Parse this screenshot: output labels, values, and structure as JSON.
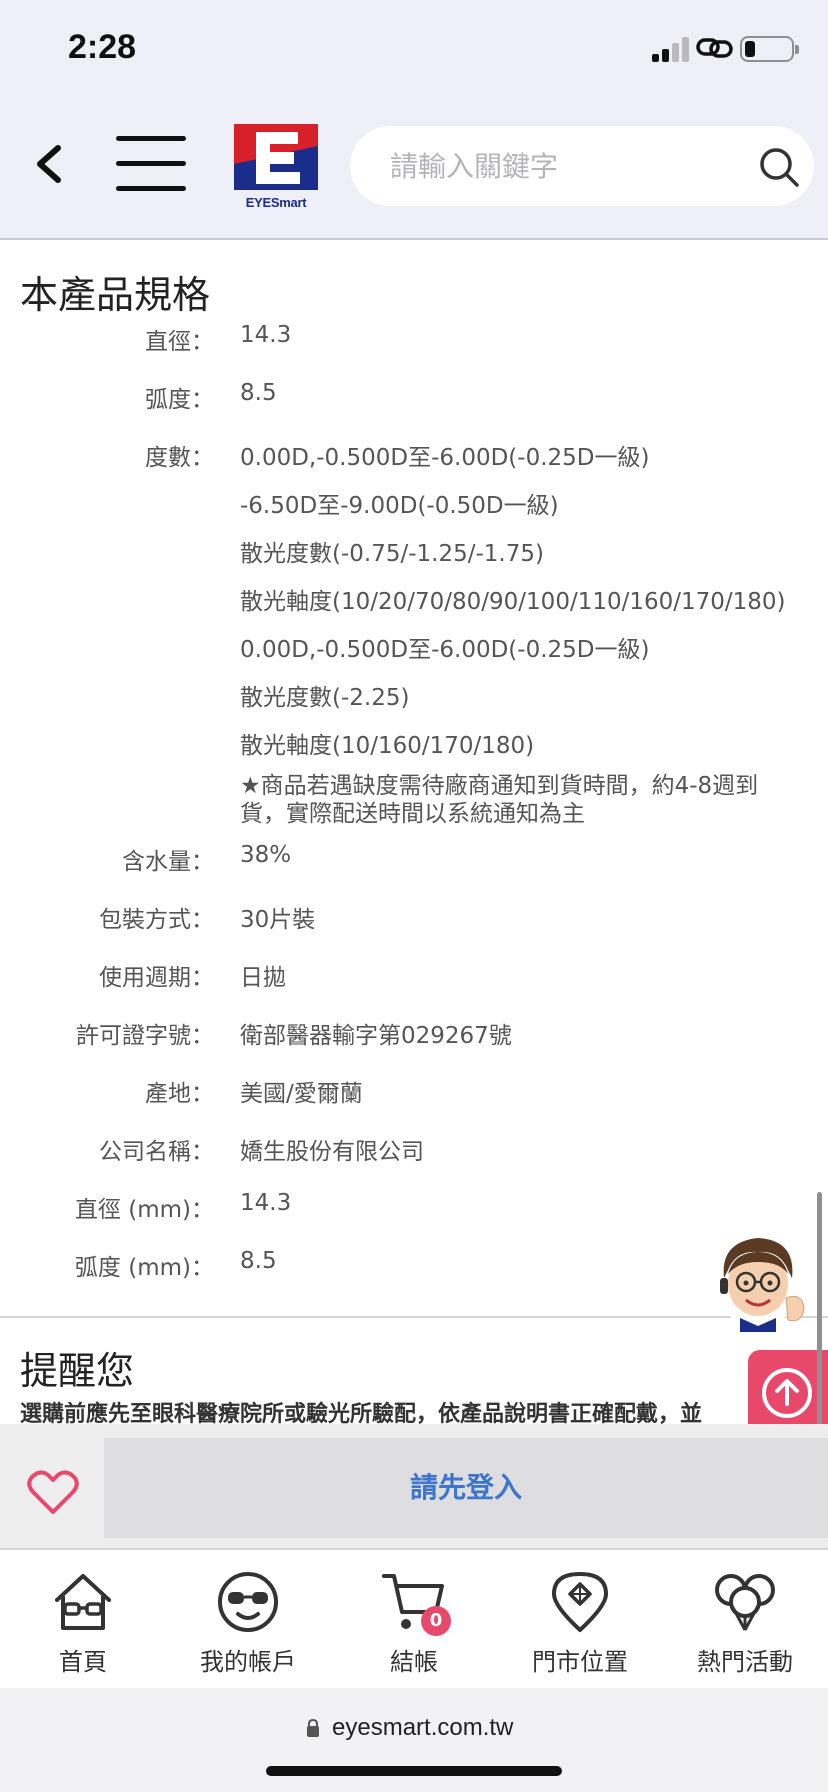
{
  "status_bar": {
    "time": "2:28"
  },
  "header": {
    "logo_text": "EYESmart",
    "search_placeholder": "請輸入關鍵字"
  },
  "specs": {
    "title": "本產品規格",
    "rows": [
      {
        "label": "直徑：",
        "value": "14.3"
      },
      {
        "label": "弧度：",
        "value": "8.5"
      },
      {
        "label": "度數：",
        "lines": [
          "0.00D,-0.500D至-6.00D(-0.25D一級)",
          "-6.50D至-9.00D(-0.50D一級)",
          "散光度數(-0.75/-1.25/-1.75)",
          "散光軸度(10/20/70/80/90/100/110/160/170/180)",
          "0.00D,-0.500D至-6.00D(-0.25D一級)",
          "散光度數(-2.25)",
          "散光軸度(10/160/170/180)"
        ],
        "note": "★商品若遇缺度需待廠商通知到貨時間，約4-8週到貨，實際配送時間以系統通知為主"
      },
      {
        "label": "含水量：",
        "value": "38%"
      },
      {
        "label": "包裝方式：",
        "value": "30片裝"
      },
      {
        "label": "使用週期：",
        "value": "日拋"
      },
      {
        "label": "許可證字號：",
        "value": "衛部醫器輸字第029267號"
      },
      {
        "label": "產地：",
        "value": "美國/愛爾蘭"
      },
      {
        "label": "公司名稱：",
        "value": "嬌生股份有限公司"
      },
      {
        "label": "直徑 (mm)：",
        "value": "14.3"
      },
      {
        "label": "弧度 (mm)：",
        "value": "8.5"
      }
    ]
  },
  "reminder": {
    "title": "提醒您",
    "text": "選購前應先至眼科醫療院所或驗光所驗配，依產品說明書正確配戴，並"
  },
  "action_bar": {
    "login_label": "請先登入"
  },
  "tab_bar": {
    "items": [
      {
        "label": "首頁",
        "icon": "home-icon"
      },
      {
        "label": "我的帳戶",
        "icon": "account-icon"
      },
      {
        "label": "結帳",
        "icon": "cart-icon",
        "badge": "0"
      },
      {
        "label": "門市位置",
        "icon": "store-location-icon"
      },
      {
        "label": "熱門活動",
        "icon": "balloons-icon"
      }
    ]
  },
  "browser": {
    "url": "eyesmart.com.tw"
  },
  "colors": {
    "accent_pink": "#e8496a",
    "login_blue": "#3d74cc",
    "header_bg": "#eff0f7",
    "logo_red": "#d7202a",
    "logo_blue": "#1a2d8a"
  }
}
